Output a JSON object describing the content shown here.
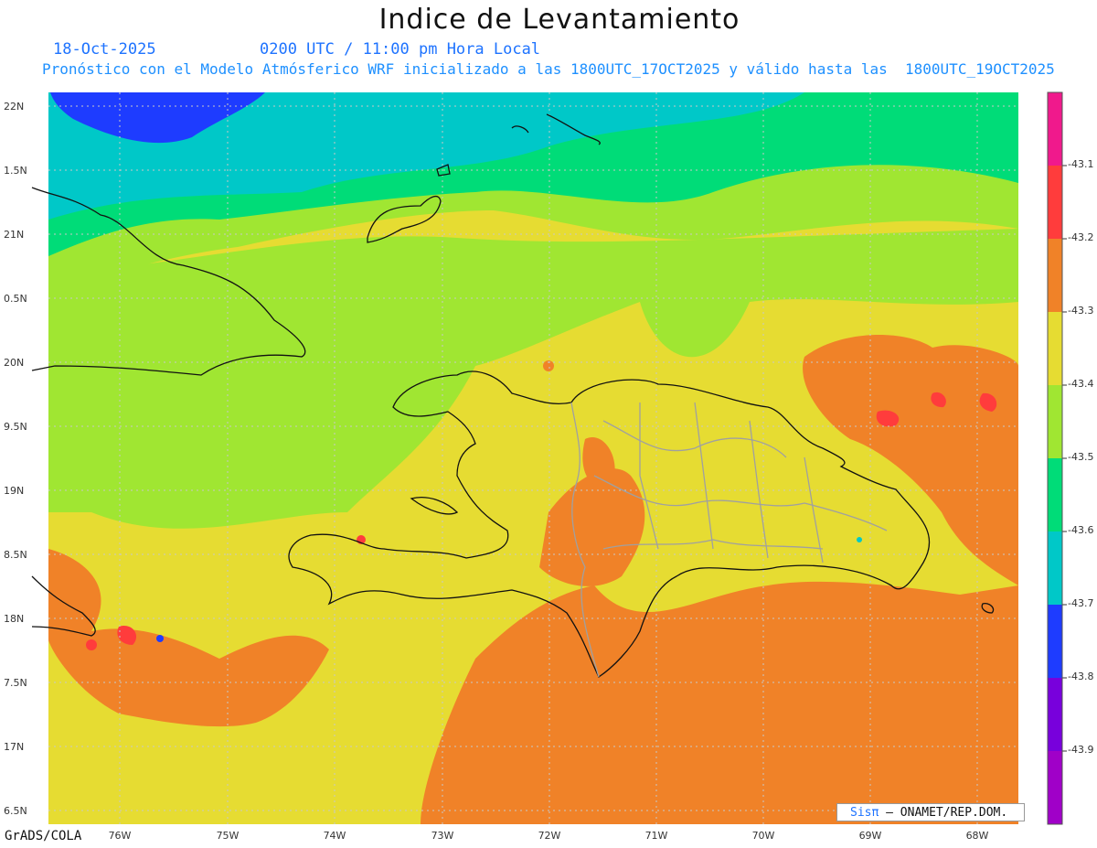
{
  "title": "Indice de Levantamiento",
  "date": "18-Oct-2025",
  "time": "0200 UTC / 11:00 pm Hora Local",
  "subtitle": "Pronóstico con el Modelo Atmósferico WRF inicializado a las 1800UTC_17OCT2025 y válido hasta las  1800UTC_19OCT2025",
  "footer_left": "GrADS/COLA",
  "credit_brand": "Sisπ",
  "credit_text": " – ONAMET/REP.DOM.",
  "lat_labels": [
    "22N",
    "1.5N",
    "21N",
    "0.5N",
    "20N",
    "9.5N",
    "19N",
    "8.5N",
    "18N",
    "7.5N",
    "17N",
    "6.5N"
  ],
  "lon_labels": [
    "76W",
    "75W",
    "74W",
    "73W",
    "72W",
    "71W",
    "70W",
    "69W",
    "68W"
  ],
  "colorbar": {
    "labels": [
      "-43.1",
      "-43.2",
      "-43.3",
      "-43.4",
      "-43.5",
      "-43.6",
      "-43.7",
      "-43.8",
      "-43.9"
    ],
    "colors": [
      "#f0198c",
      "#ff3c3c",
      "#f08228",
      "#e6dc32",
      "#a0e632",
      "#00dc78",
      "#00c8c8",
      "#1e3cff",
      "#7800dc",
      "#a000c8"
    ]
  },
  "legend_colors": {
    "ocean_far_north": "#1e3cff",
    "cyan": "#00c8c8",
    "green": "#00dc78",
    "light_green": "#a0e632",
    "yellow": "#e6dc32",
    "orange": "#f08228",
    "red": "#ff3c3c"
  }
}
